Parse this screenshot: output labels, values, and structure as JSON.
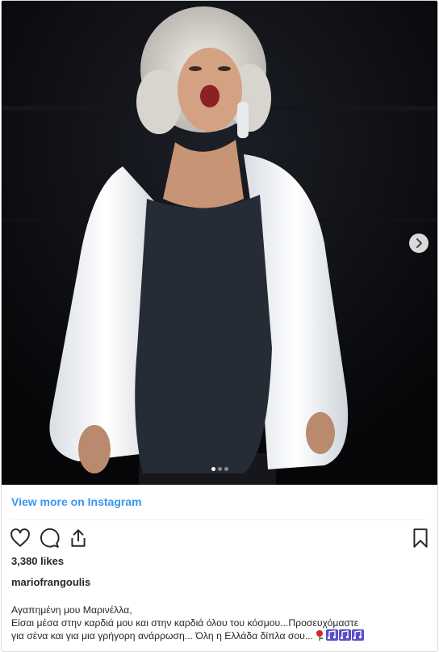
{
  "post": {
    "more_link": "View more on Instagram",
    "likes": "3,380 likes",
    "username": "mariofrangoulis",
    "caption_lines": [
      "Αγαπημένη μου Μαρινέλλα,",
      "Είσαι μέσα στην καρδιά μου και στην καρδιά όλου του κόσμου...Προσευχόμαστε",
      "για σένα και για μια γρήγορη ανάρρωση... Όλη η Ελλάδα δίπλα σου..."
    ],
    "caption_emojis": [
      "rose-emoji",
      "musical-notes-emoji",
      "musical-notes-emoji",
      "musical-notes-emoji"
    ],
    "carousel": {
      "count": 3,
      "active_index": 0
    },
    "icons": {
      "like": "heart-icon",
      "comment": "comment-icon",
      "share": "share-icon",
      "save": "bookmark-icon",
      "next": "chevron-right-icon"
    },
    "colors": {
      "link": "#3897f0",
      "text": "#262626",
      "border": "#dbdbdb",
      "photo_background": "#0c0c0f"
    }
  }
}
